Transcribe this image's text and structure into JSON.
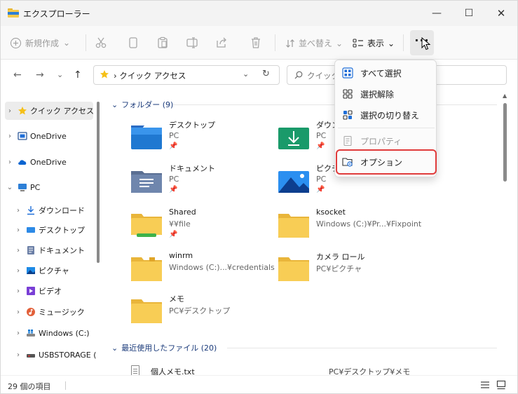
{
  "window": {
    "title": "エクスプローラー",
    "minimize": "—",
    "maximize": "☐",
    "close": "✕"
  },
  "toolbar": {
    "new_label": "新規作成",
    "new_chevron": "⌄",
    "sort_label": "並べ替え",
    "sort_chevron": "⌄",
    "view_label": "表示",
    "view_chevron": "⌄",
    "more_label": "···"
  },
  "address": {
    "back": "←",
    "forward": "→",
    "recent_chevron": "⌄",
    "up": "↑",
    "path": "› クイック アクセス",
    "dropdown": "⌄",
    "refresh": "↻",
    "search_placeholder": "クイック"
  },
  "sidebar": {
    "items": [
      {
        "label": "クイック アクセス",
        "chevron": "›",
        "icon": "star-icon"
      },
      {
        "label": "OneDrive",
        "chevron": "›",
        "icon": "onedrive-personal-icon"
      },
      {
        "label": "OneDrive",
        "chevron": "›",
        "icon": "onedrive-cloud-icon"
      },
      {
        "label": "PC",
        "chevron": "⌄",
        "icon": "pc-icon"
      },
      {
        "label": "ダウンロード",
        "chevron": "›",
        "icon": "download-icon"
      },
      {
        "label": "デスクトップ",
        "chevron": "›",
        "icon": "desktop-icon"
      },
      {
        "label": "ドキュメント",
        "chevron": "›",
        "icon": "documents-icon"
      },
      {
        "label": "ピクチャ",
        "chevron": "›",
        "icon": "pictures-icon"
      },
      {
        "label": "ビデオ",
        "chevron": "›",
        "icon": "videos-icon"
      },
      {
        "label": "ミュージック",
        "chevron": "›",
        "icon": "music-icon"
      },
      {
        "label": "Windows (C:)",
        "chevron": "›",
        "icon": "drive-icon"
      },
      {
        "label": "USBSTORAGE (",
        "chevron": "›",
        "icon": "usb-drive-icon"
      }
    ]
  },
  "folders": {
    "header": "フォルダー (9)",
    "items": [
      {
        "name": "デスクトップ",
        "location": "PC",
        "pin": "📌"
      },
      {
        "name": "ダウンロ",
        "location": "PC",
        "pin": "📌"
      },
      {
        "name": "ドキュメント",
        "location": "PC",
        "pin": "📌"
      },
      {
        "name": "ピクチャ",
        "location": "PC",
        "pin": "📌"
      },
      {
        "name": "Shared",
        "location": "¥¥file",
        "pin": "📌"
      },
      {
        "name": "ksocket",
        "location": "Windows (C:)¥Pr...¥Fixpoint",
        "pin": ""
      },
      {
        "name": "winrm",
        "location": "Windows (C:)...¥credentials",
        "pin": ""
      },
      {
        "name": "カメラ ロール",
        "location": "PC¥ピクチャ",
        "pin": ""
      },
      {
        "name": "メモ",
        "location": "PC¥デスクトップ",
        "pin": ""
      }
    ]
  },
  "recent": {
    "header": "最近使用したファイル (20)",
    "items": [
      {
        "name": "個人メモ.txt",
        "location": "PC¥デスクトップ¥メモ"
      }
    ]
  },
  "status": {
    "count": "29 個の項目"
  },
  "menu": {
    "items": [
      {
        "label": "すべて選択",
        "icon": "select-all-icon",
        "disabled": false
      },
      {
        "label": "選択解除",
        "icon": "select-none-icon",
        "disabled": false
      },
      {
        "label": "選択の切り替え",
        "icon": "invert-selection-icon",
        "disabled": false
      },
      {
        "label": "プロパティ",
        "icon": "properties-icon",
        "disabled": true
      },
      {
        "label": "オプション",
        "icon": "options-icon",
        "disabled": false,
        "highlighted": true
      }
    ]
  },
  "colors": {
    "folder": "#f8cd55",
    "accent": "#2d7fd6",
    "highlight_box": "#e03b3b"
  }
}
